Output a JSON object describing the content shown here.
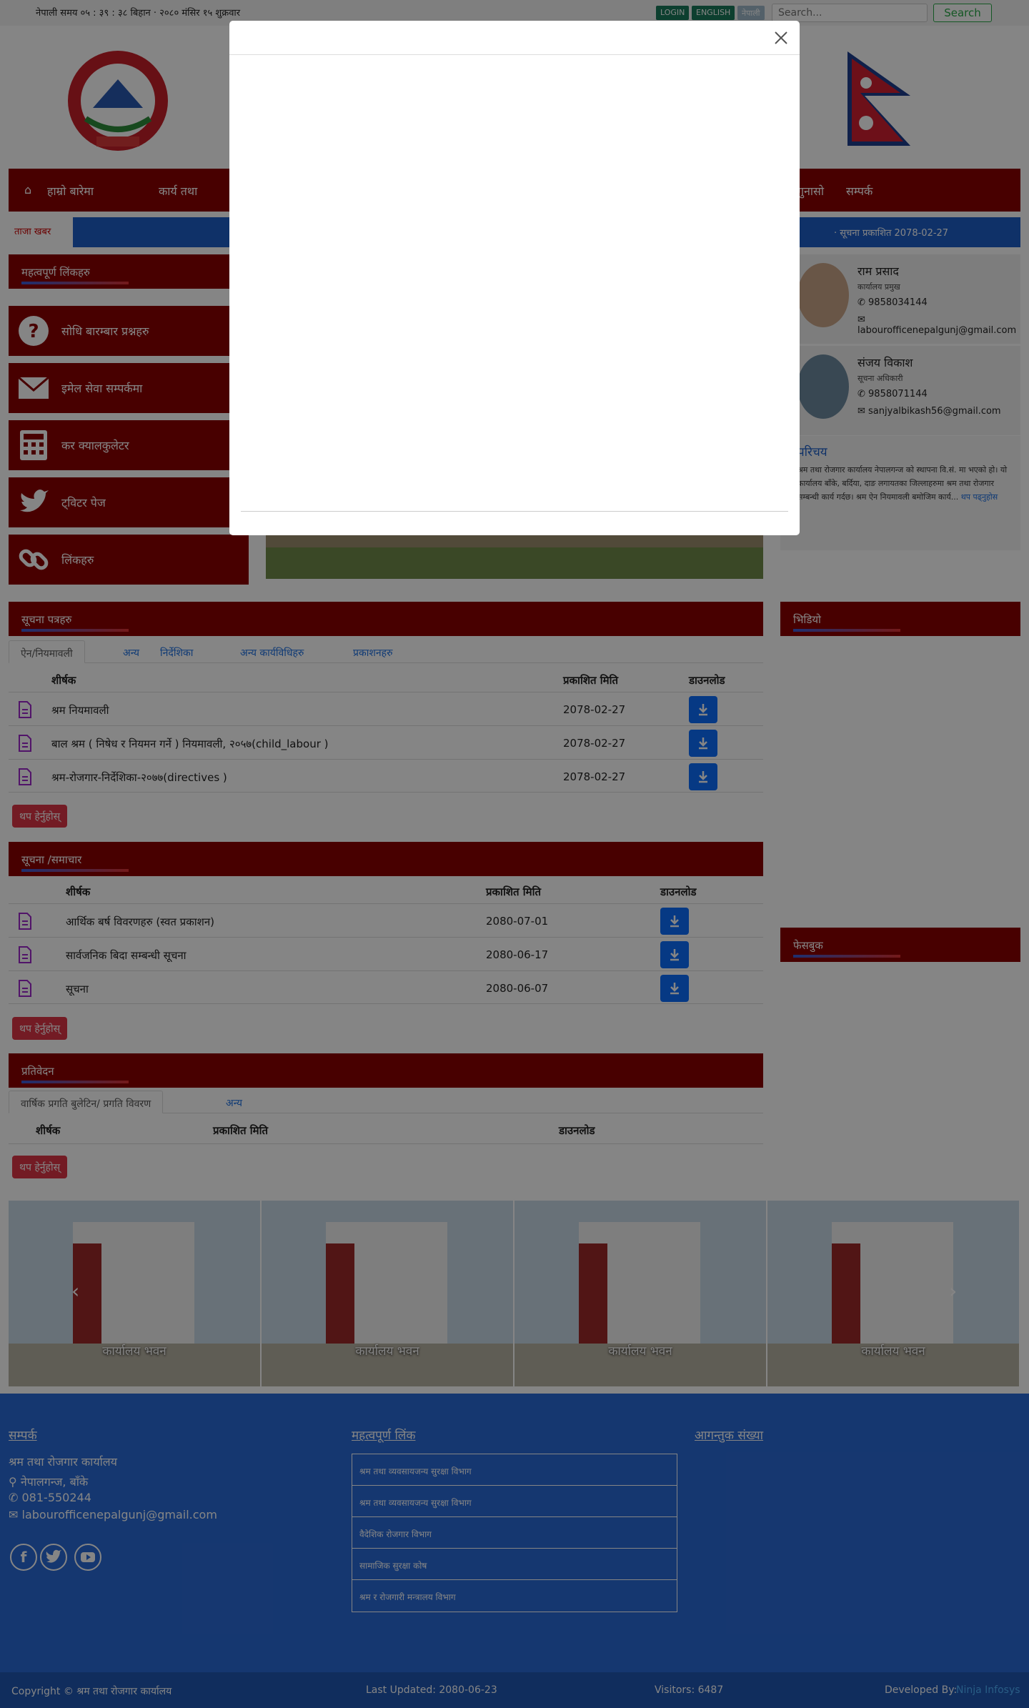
{
  "topbar": {
    "clock": "नेपाली समय ०५ : ३९ : ३८ बिहान · २०८० मंसिर १५ शुक्रवार",
    "login": "LOGIN",
    "english": "ENGLISH",
    "nepali": "नेपाली",
    "search_placeholder": "Search...",
    "search_button": "Search",
    "colors": {
      "login": "#1a7a5a",
      "english": "#1a7a5a",
      "nepali": "#9fb9c9"
    }
  },
  "nav": {
    "home_icon": "home-icon",
    "items": [
      "हाम्रो बारेमा",
      "कार्य तथा",
      "गुनासो",
      "सम्पर्क"
    ]
  },
  "ticker": {
    "label": "ताजा खबर",
    "news": "· सूचना प्रकाशित 2078-02-27"
  },
  "sidebar": {
    "head": "महत्वपूर्ण लिंकहरु",
    "buttons": [
      {
        "label": "सोधि बारम्बार प्रश्नहरु",
        "icon": "question-icon"
      },
      {
        "label": "इमेल सेवा सम्पर्कमा",
        "icon": "envelope-icon"
      },
      {
        "label": "कर क्यालकुलेटर",
        "icon": "calculator-icon"
      },
      {
        "label": "ट्विटर पेज",
        "icon": "twitter-icon"
      },
      {
        "label": "लिंकहरु",
        "icon": "link-icon"
      }
    ]
  },
  "staff": [
    {
      "name": "राम प्रसाद",
      "role": "कार्यालय प्रमुख",
      "phone": "9858034144",
      "email": "labourofficenepalgunj@gmail.com"
    },
    {
      "name": "संजय विकाश",
      "role": "सूचना अधिकारी",
      "phone": "9858071144",
      "email": "sanjyalbikash56@gmail.com"
    }
  ],
  "intro": {
    "title": "परिचय",
    "body": "श्रम तथा रोजगार कार्यालय नेपालगन्ज को स्थापना वि.सं. मा भएको हो। यो कार्यालय बाँके, बर्दिया, दाङ लगायतका जिल्लाहरुमा श्रम तथा रोजगार सम्बन्धी कार्य गर्दछ। श्रम ऐन नियमावली बमोजिम कार्य...",
    "more": "थप पढ्नुहोस"
  },
  "notices": {
    "head": "सूचना पत्रहरु",
    "tabs": [
      "ऐन/नियमावली",
      "अन्य",
      "निर्देशिका",
      "अन्य कार्यविधिहरु",
      "प्रकाशनहरु"
    ],
    "columns": [
      "शीर्षक",
      "प्रकाशित मिति",
      "डाउनलोड"
    ],
    "rows": [
      {
        "title": "श्रम नियमावली",
        "date": "2078-02-27"
      },
      {
        "title": "बाल श्रम ( निषेध र नियमन गर्ने ) नियमावली, २०५७(child_labour )",
        "date": "2078-02-27"
      },
      {
        "title": "श्रम-रोजगार-निर्देशिका-२०७७(directives )",
        "date": "2078-02-27"
      }
    ],
    "more": "थप हेर्नुहोस्"
  },
  "news": {
    "head": "सूचना /समाचार",
    "columns": [
      "शीर्षक",
      "प्रकाशित मिति",
      "डाउनलोड"
    ],
    "rows": [
      {
        "title": "आर्थिक बर्ष विवरणहरु (स्वत प्रकाशन)",
        "date": "2080-07-01"
      },
      {
        "title": "सार्वजनिक बिदा सम्बन्धी सूचना",
        "date": "2080-06-17"
      },
      {
        "title": "सूचना",
        "date": "2080-06-07"
      }
    ],
    "more": "थप हेर्नुहोस्"
  },
  "reports": {
    "head": "प्रतिवेदन",
    "tabs": [
      "वार्षिक प्रगति बुलेटिन/ प्रगति विवरण",
      "अन्य"
    ],
    "columns": [
      "शीर्षक",
      "प्रकाशित मिति",
      "डाउनलोड"
    ],
    "more": "थप हेर्नुहोस्"
  },
  "right_heads": [
    "भिडियो",
    "फेसबुक"
  ],
  "gallery": {
    "captions": [
      "कार्यालय भवन",
      "कार्यालय भवन",
      "कार्यालय भवन",
      "कार्यालय भवन"
    ]
  },
  "footer": {
    "contact_head": "सम्पर्क",
    "office": "श्रम तथा रोजगार कार्यालय",
    "address": "नेपालगन्ज, बाँके",
    "phone": "081-550244",
    "email": "labourofficenepalgunj@gmail.com",
    "links_head": "महत्वपूर्ण लिंक",
    "links": [
      "श्रम तथा व्यवसायजन्य सुरक्षा विभाग",
      "श्रम तथा व्यवसायजन्य सुरक्षा विभाग",
      "वैदेशिक रोजगार विभाग",
      "सामाजिक सुरक्षा कोष",
      "श्रम र रोजगारी मन्त्रालय विभाग"
    ],
    "visitors_head": "आगन्तुक संख्या",
    "social": [
      "facebook-icon",
      "twitter-icon",
      "youtube-icon"
    ]
  },
  "copyright": {
    "left": "Copyright © श्रम तथा रोजगार कार्यालय",
    "updated": "Last Updated: 2080-06-23",
    "visitors": "Visitors: 6487",
    "dev_label": "Developed By:",
    "dev_name": "Ninja Infosys"
  },
  "colors": {
    "maroon": "#8b0000",
    "blue": "#2a6ad6",
    "download": "#0d6efd",
    "more": "#dc3545"
  }
}
